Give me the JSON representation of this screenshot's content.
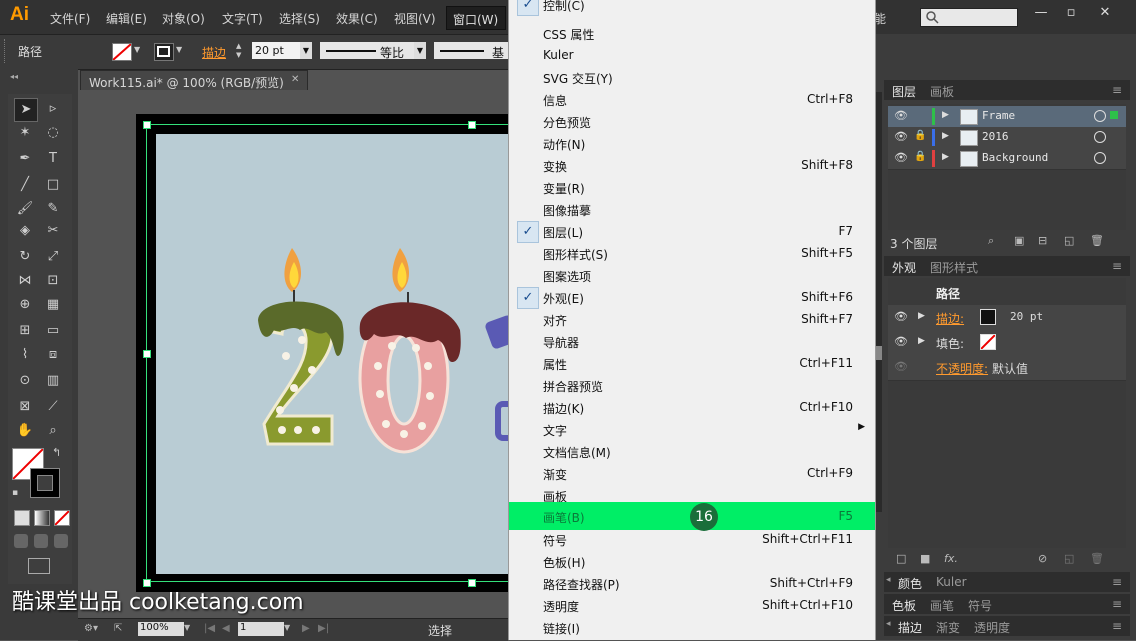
{
  "app": {
    "logo": "Ai"
  },
  "menubar": {
    "items": [
      "文件(F)",
      "编辑(E)",
      "对象(O)",
      "文字(T)",
      "选择(S)",
      "效果(C)",
      "视图(V)",
      "窗口(W)"
    ],
    "partial_right": "能"
  },
  "control_bar": {
    "selection_label": "路径",
    "stroke_label": "描边",
    "stroke_value": "20 pt",
    "profile_label": "等比",
    "brush_label": "基"
  },
  "document": {
    "tab_title": "Work115.ai* @ 100% (RGB/预览)",
    "close_glyph": "✕"
  },
  "status_bar": {
    "zoom": "100%",
    "page": "1",
    "tool_name": "选择"
  },
  "window_menu": {
    "items": [
      {
        "label": "控制(C)",
        "shortcut": "",
        "checked": true,
        "submenu": false,
        "highlighted": false
      },
      {
        "label": "CSS 属性",
        "shortcut": "",
        "checked": false,
        "submenu": false,
        "highlighted": false
      },
      {
        "label": "Kuler",
        "shortcut": "",
        "checked": false,
        "submenu": false,
        "highlighted": false
      },
      {
        "label": "SVG 交互(Y)",
        "shortcut": "",
        "checked": false,
        "submenu": false,
        "highlighted": false
      },
      {
        "label": "信息",
        "shortcut": "Ctrl+F8",
        "checked": false,
        "submenu": false,
        "highlighted": false
      },
      {
        "label": "分色预览",
        "shortcut": "",
        "checked": false,
        "submenu": false,
        "highlighted": false
      },
      {
        "label": "动作(N)",
        "shortcut": "",
        "checked": false,
        "submenu": false,
        "highlighted": false
      },
      {
        "label": "变换",
        "shortcut": "Shift+F8",
        "checked": false,
        "submenu": false,
        "highlighted": false
      },
      {
        "label": "变量(R)",
        "shortcut": "",
        "checked": false,
        "submenu": false,
        "highlighted": false
      },
      {
        "label": "图像描摹",
        "shortcut": "",
        "checked": false,
        "submenu": false,
        "highlighted": false
      },
      {
        "label": "图层(L)",
        "shortcut": "F7",
        "checked": true,
        "submenu": false,
        "highlighted": false
      },
      {
        "label": "图形样式(S)",
        "shortcut": "Shift+F5",
        "checked": false,
        "submenu": false,
        "highlighted": false
      },
      {
        "label": "图案选项",
        "shortcut": "",
        "checked": false,
        "submenu": false,
        "highlighted": false
      },
      {
        "label": "外观(E)",
        "shortcut": "Shift+F6",
        "checked": true,
        "submenu": false,
        "highlighted": false
      },
      {
        "label": "对齐",
        "shortcut": "Shift+F7",
        "checked": false,
        "submenu": false,
        "highlighted": false
      },
      {
        "label": "导航器",
        "shortcut": "",
        "checked": false,
        "submenu": false,
        "highlighted": false
      },
      {
        "label": "属性",
        "shortcut": "Ctrl+F11",
        "checked": false,
        "submenu": false,
        "highlighted": false
      },
      {
        "label": "拼合器预览",
        "shortcut": "",
        "checked": false,
        "submenu": false,
        "highlighted": false
      },
      {
        "label": "描边(K)",
        "shortcut": "Ctrl+F10",
        "checked": false,
        "submenu": false,
        "highlighted": false
      },
      {
        "label": "文字",
        "shortcut": "",
        "checked": false,
        "submenu": true,
        "highlighted": false
      },
      {
        "label": "文档信息(M)",
        "shortcut": "",
        "checked": false,
        "submenu": false,
        "highlighted": false
      },
      {
        "label": "渐变",
        "shortcut": "Ctrl+F9",
        "checked": false,
        "submenu": false,
        "highlighted": false
      },
      {
        "label": "画板",
        "shortcut": "",
        "checked": false,
        "submenu": false,
        "highlighted": false
      },
      {
        "label": "画笔(B)",
        "shortcut": "F5",
        "checked": false,
        "submenu": false,
        "highlighted": true
      },
      {
        "label": "符号",
        "shortcut": "Shift+Ctrl+F11",
        "checked": false,
        "submenu": false,
        "highlighted": false
      },
      {
        "label": "色板(H)",
        "shortcut": "",
        "checked": false,
        "submenu": false,
        "highlighted": false
      },
      {
        "label": "路径查找器(P)",
        "shortcut": "Shift+Ctrl+F9",
        "checked": false,
        "submenu": false,
        "highlighted": false
      },
      {
        "label": "透明度",
        "shortcut": "Shift+Ctrl+F10",
        "checked": false,
        "submenu": false,
        "highlighted": false
      },
      {
        "label": "链接(I)",
        "shortcut": "",
        "checked": false,
        "submenu": false,
        "highlighted": false
      }
    ],
    "check_glyph": "✓",
    "submenu_glyph": "▶",
    "step_badge": "16"
  },
  "layers_panel": {
    "tabs": [
      "图层",
      "画板"
    ],
    "layers": [
      {
        "name": "Frame",
        "color": "#2ec04a",
        "selected": true
      },
      {
        "name": "2016",
        "color": "#3a6ee8",
        "selected": false
      },
      {
        "name": "Background",
        "color": "#e04040",
        "selected": false
      }
    ],
    "count_label": "3 个图层"
  },
  "appearance_panel": {
    "tabs": [
      "外观",
      "图形样式"
    ],
    "title": "路径",
    "stroke_label": "描边:",
    "stroke_value": "20 pt",
    "fill_label": "填色:",
    "opacity_label": "不透明度:",
    "opacity_value": "默认值",
    "fx_label": "fx."
  },
  "bottom_panels": [
    {
      "tabs": [
        "颜色",
        "Kuler"
      ]
    },
    {
      "tabs": [
        "色板",
        "画笔",
        "符号"
      ]
    },
    {
      "tabs": [
        "描边",
        "渐变",
        "透明度"
      ]
    }
  ],
  "watermark": "酷课堂出品 coolketang.com",
  "colors": {
    "highlight": "#00ee66",
    "artboard_bg": "#b9ccd4",
    "candle_green": "#8a9a2e",
    "candle_pink": "#e8a0a0",
    "drip_dark": "#5a2a2a",
    "ai_orange": "#ff9a00"
  }
}
